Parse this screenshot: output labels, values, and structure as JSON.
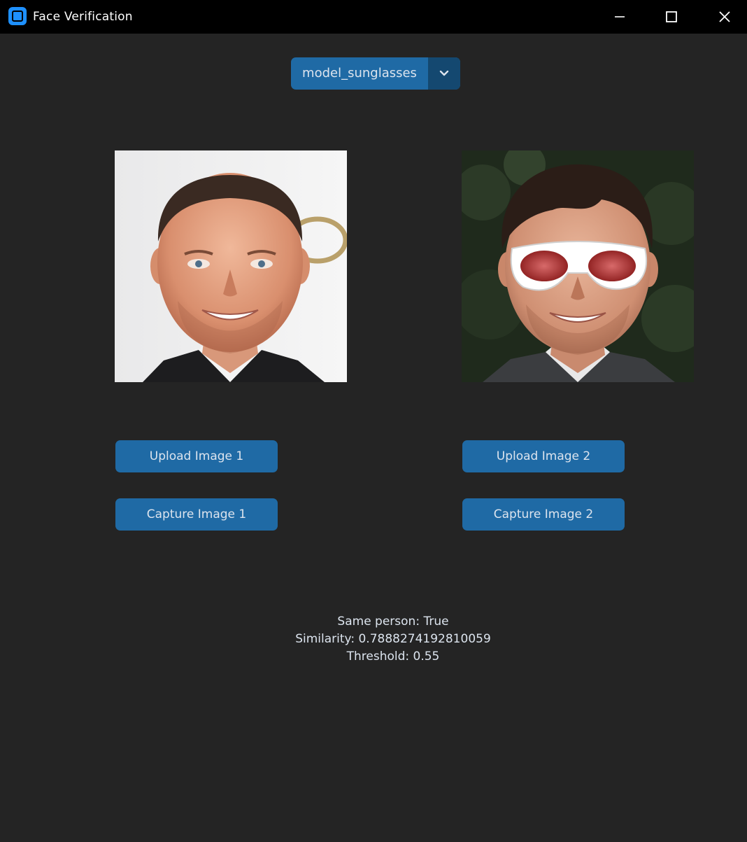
{
  "window": {
    "title": "Face Verification",
    "icon": "app-icon",
    "controls": [
      "minimize-icon",
      "maximize-icon",
      "close-icon"
    ]
  },
  "model_selector": {
    "selected": "model_sunglasses",
    "icon": "chevron-down-icon"
  },
  "images": {
    "image1": {
      "description_icon": "face-photo"
    },
    "image2": {
      "description_icon": "face-photo-sunglasses"
    }
  },
  "buttons": {
    "upload1": "Upload Image 1",
    "capture1": "Capture Image 1",
    "upload2": "Upload Image 2",
    "capture2": "Capture Image 2"
  },
  "result": {
    "same_person": "Same person: True",
    "similarity": "Similarity: 0.7888274192810059",
    "threshold": "Threshold: 0.55"
  },
  "colors": {
    "background": "#242424",
    "titlebar": "#000000",
    "accent": "#1f6aa5",
    "accent_dark": "#144870",
    "text": "#dce4ee"
  }
}
